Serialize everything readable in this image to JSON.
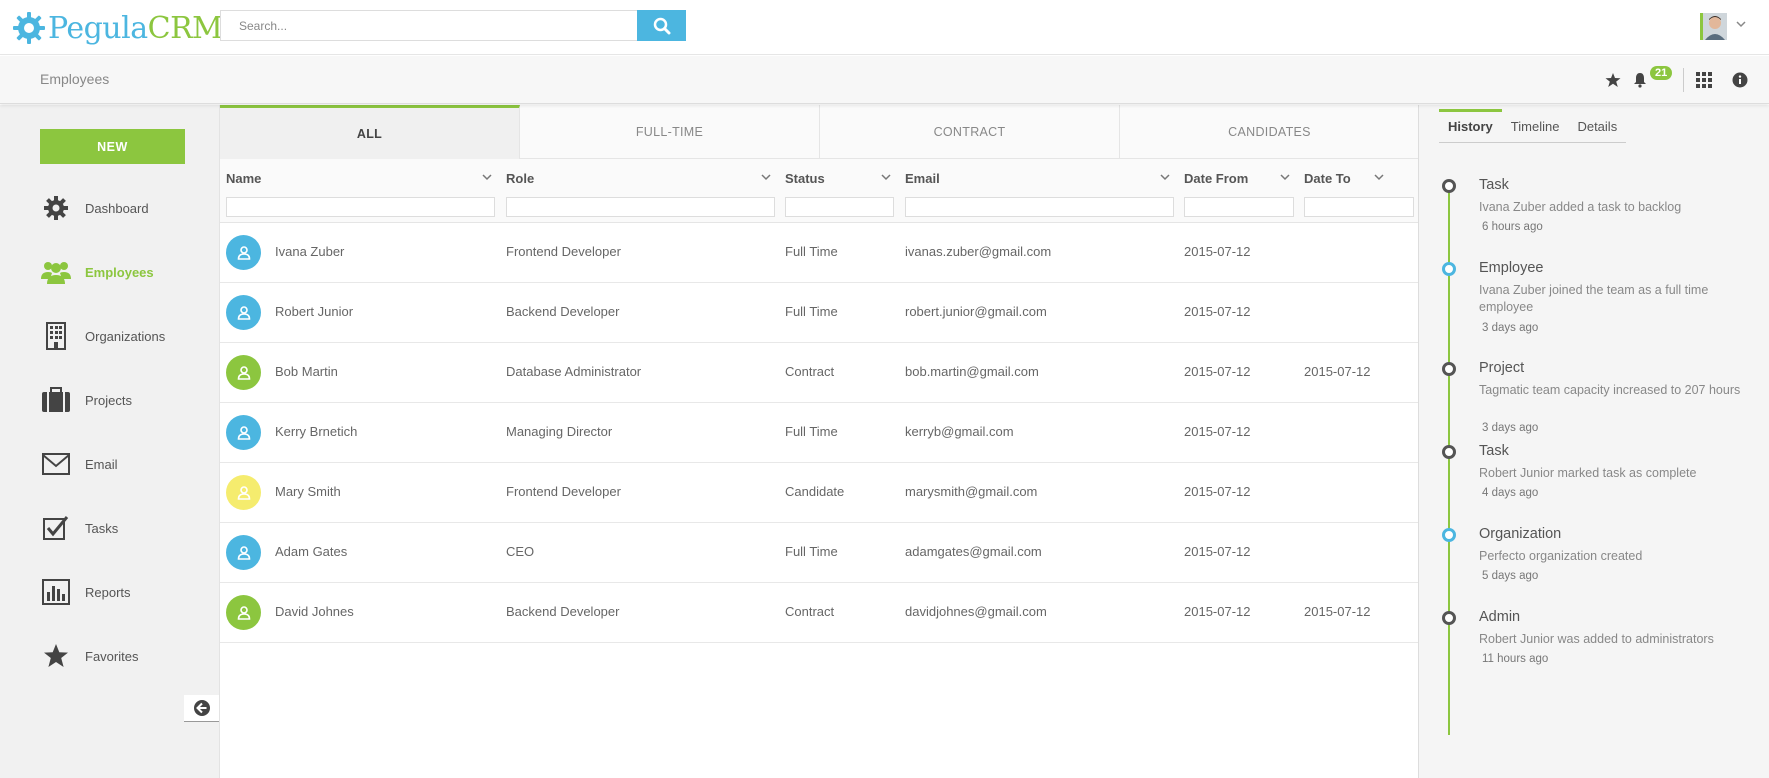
{
  "app": {
    "logo_part1": "Pegula",
    "logo_part2": "CRM",
    "search_placeholder": "Search..."
  },
  "header": {
    "page_title": "Employees",
    "notification_count": "21"
  },
  "sidebar": {
    "new_label": "NEW",
    "items": [
      {
        "label": "Dashboard",
        "icon": "gear-icon"
      },
      {
        "label": "Employees",
        "icon": "users-icon",
        "active": true
      },
      {
        "label": "Organizations",
        "icon": "building-icon"
      },
      {
        "label": "Projects",
        "icon": "briefcase-icon"
      },
      {
        "label": "Email",
        "icon": "envelope-icon"
      },
      {
        "label": "Tasks",
        "icon": "checkbox-icon"
      },
      {
        "label": "Reports",
        "icon": "bar-chart-icon"
      },
      {
        "label": "Favorites",
        "icon": "star-icon"
      }
    ]
  },
  "tabs": [
    {
      "label": "ALL",
      "active": true
    },
    {
      "label": "FULL-TIME"
    },
    {
      "label": "CONTRACT"
    },
    {
      "label": "CANDIDATES"
    }
  ],
  "table": {
    "columns": [
      "Name",
      "Role",
      "Status",
      "Email",
      "Date From",
      "Date To"
    ],
    "rows": [
      {
        "name": "Ivana Zuber",
        "role": "Frontend Developer",
        "status": "Full Time",
        "email": "ivanas.zuber@gmail.com",
        "date_from": "2015-07-12",
        "date_to": "",
        "avatar_color": "#4cb6e0"
      },
      {
        "name": "Robert Junior",
        "role": "Backend Developer",
        "status": "Full Time",
        "email": "robert.junior@gmail.com",
        "date_from": "2015-07-12",
        "date_to": "",
        "avatar_color": "#4cb6e0"
      },
      {
        "name": "Bob Martin",
        "role": "Database Administrator",
        "status": "Contract",
        "email": "bob.martin@gmail.com",
        "date_from": "2015-07-12",
        "date_to": "2015-07-12",
        "avatar_color": "#8cc63f"
      },
      {
        "name": "Kerry Brnetich",
        "role": "Managing Director",
        "status": "Full Time",
        "email": "kerryb@gmail.com",
        "date_from": "2015-07-12",
        "date_to": "",
        "avatar_color": "#4cb6e0"
      },
      {
        "name": "Mary Smith",
        "role": "Frontend Developer",
        "status": "Candidate",
        "email": "marysmith@gmail.com",
        "date_from": "2015-07-12",
        "date_to": "",
        "avatar_color": "#f5ec6e"
      },
      {
        "name": "Adam Gates",
        "role": "CEO",
        "status": "Full Time",
        "email": "adamgates@gmail.com",
        "date_from": "2015-07-12",
        "date_to": "",
        "avatar_color": "#4cb6e0"
      },
      {
        "name": "David Johnes",
        "role": "Backend Developer",
        "status": "Contract",
        "email": "davidjohnes@gmail.com",
        "date_from": "2015-07-12",
        "date_to": "2015-07-12",
        "avatar_color": "#8cc63f"
      }
    ]
  },
  "right_panel": {
    "tabs": [
      "History",
      "Timeline",
      "Details"
    ],
    "history": [
      {
        "title": "Task",
        "desc": "Ivana Zuber added a task to backlog",
        "time": "6 hours ago",
        "dot": "dark"
      },
      {
        "title": "Employee",
        "desc": "Ivana Zuber joined the team as a full time employee",
        "time": "3 days ago",
        "dot": "blue"
      },
      {
        "title": "Project",
        "desc": "Tagmatic team capacity increased to 207 hours",
        "time": "3 days ago",
        "dot": "dark"
      },
      {
        "title": "Task",
        "desc": "Robert Junior marked task as complete",
        "time": "4 days ago",
        "dot": "dark"
      },
      {
        "title": "Organization",
        "desc": "Perfecto organization created",
        "time": "5 days ago",
        "dot": "blue"
      },
      {
        "title": "Admin",
        "desc": "Robert Junior was added to administrators",
        "time": "11 hours ago",
        "dot": "dark"
      }
    ]
  },
  "colors": {
    "accent_green": "#8cc63f",
    "accent_blue": "#4cb6e0"
  }
}
